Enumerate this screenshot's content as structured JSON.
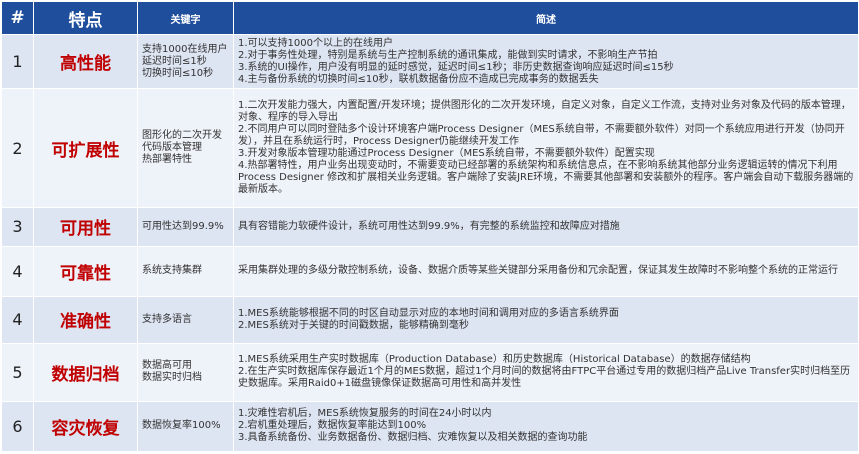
{
  "header": {
    "num": "#",
    "feature": "特点",
    "keyword": "关键字",
    "description": "简述"
  },
  "rows": [
    {
      "num": "1",
      "feature": "高性能",
      "keywords": [
        "支持1000在线用户",
        "延迟时间≤1秒",
        "切换时间≤10秒"
      ],
      "desc": [
        "1.可以支持1000个以上的在线用户",
        "2.对于事务性处理，特别是系统与生产控制系统的通讯集成，能做到实时请求，不影响生产节拍",
        "3.系统的UI操作，用户没有明显的延时感觉，延迟时间≤1秒；非历史数据查询响应延迟时间≤15秒",
        "4.主与备份系统的切换时间≤10秒，联机数据备份应不造成已完成事务的数据丢失"
      ]
    },
    {
      "num": "2",
      "feature": "可扩展性",
      "keywords": [
        "图形化的二次开发",
        "代码版本管理",
        "热部署特性"
      ],
      "desc": [
        "1.二次开发能力强大，内置配置/开发环境；提供图形化的二次开发环境，自定义对象，自定义工作流，支持对业务对象及代码的版本管理，对象、程序的导入导出",
        "2.不同用户可以同时登陆多个设计环境客户端Process Designer（MES系统自带，不需要额外软件）对同一个系统应用进行开发（协同开发），并且在系统运行时，Process Designer仍能继续开发工作",
        "3.开发对象版本管理功能通过Process Designer（MES系统自带，不需要额外软件）配置实现",
        "4.热部署特性，用户业务出现变动时，不需要变动已经部署的系统架构和系统信息点，在不影响系统其他部分业务逻辑运转的情况下利用Process Designer 修改和扩展相关业务逻辑。客户端除了安装JRE环境，不需要其他部署和安装额外的程序。客户端会自动下载服务器端的最新版本。"
      ]
    },
    {
      "num": "3",
      "feature": "可用性",
      "keywords": [
        "可用性达到99.9%"
      ],
      "desc": [
        "具有容错能力软硬件设计，系统可用性达到99.9%，有完整的系统监控和故障应对措施"
      ]
    },
    {
      "num": "4",
      "feature": "可靠性",
      "keywords": [
        "系统支持集群"
      ],
      "desc": [
        "采用集群处理的多级分散控制系统，设备、数据介质等某些关键部分采用备份和冗余配置，保证其发生故障时不影响整个系统的正常运行"
      ]
    },
    {
      "num": "4",
      "feature": "准确性",
      "keywords": [
        "支持多语言"
      ],
      "desc": [
        "1.MES系统能够根据不同的时区自动显示对应的本地时间和调用对应的多语言系统界面",
        "2.MES系统对于关键的时间戳数据，能够精确到毫秒"
      ]
    },
    {
      "num": "5",
      "feature": "数据归档",
      "keywords": [
        "数据高可用",
        "数据实时归档"
      ],
      "desc": [
        "1.MES系统采用生产实时数据库（Production Database）和历史数据库（Historical Database）的数据存储结构",
        "2.在生产实时数据库保存最近1个月的MES数据，超过1个月时间的数据将由FTPC平台通过专用的数据归档产品Live Transfer实时归档至历史数据库。采用Raid0+1磁盘镜像保证数据高可用性和高并发性"
      ]
    },
    {
      "num": "6",
      "feature": "容灾恢复",
      "keywords": [
        "数据恢复率100%"
      ],
      "desc": [
        "1.灾难性宕机后，MES系统恢复服务的时间在24小时以内",
        "2.宕机重处理后，数据恢复率能达到100%",
        "3.具备系统备份、业务数据备份、数据归档、灾难恢复以及相关数据的查询功能"
      ]
    }
  ]
}
